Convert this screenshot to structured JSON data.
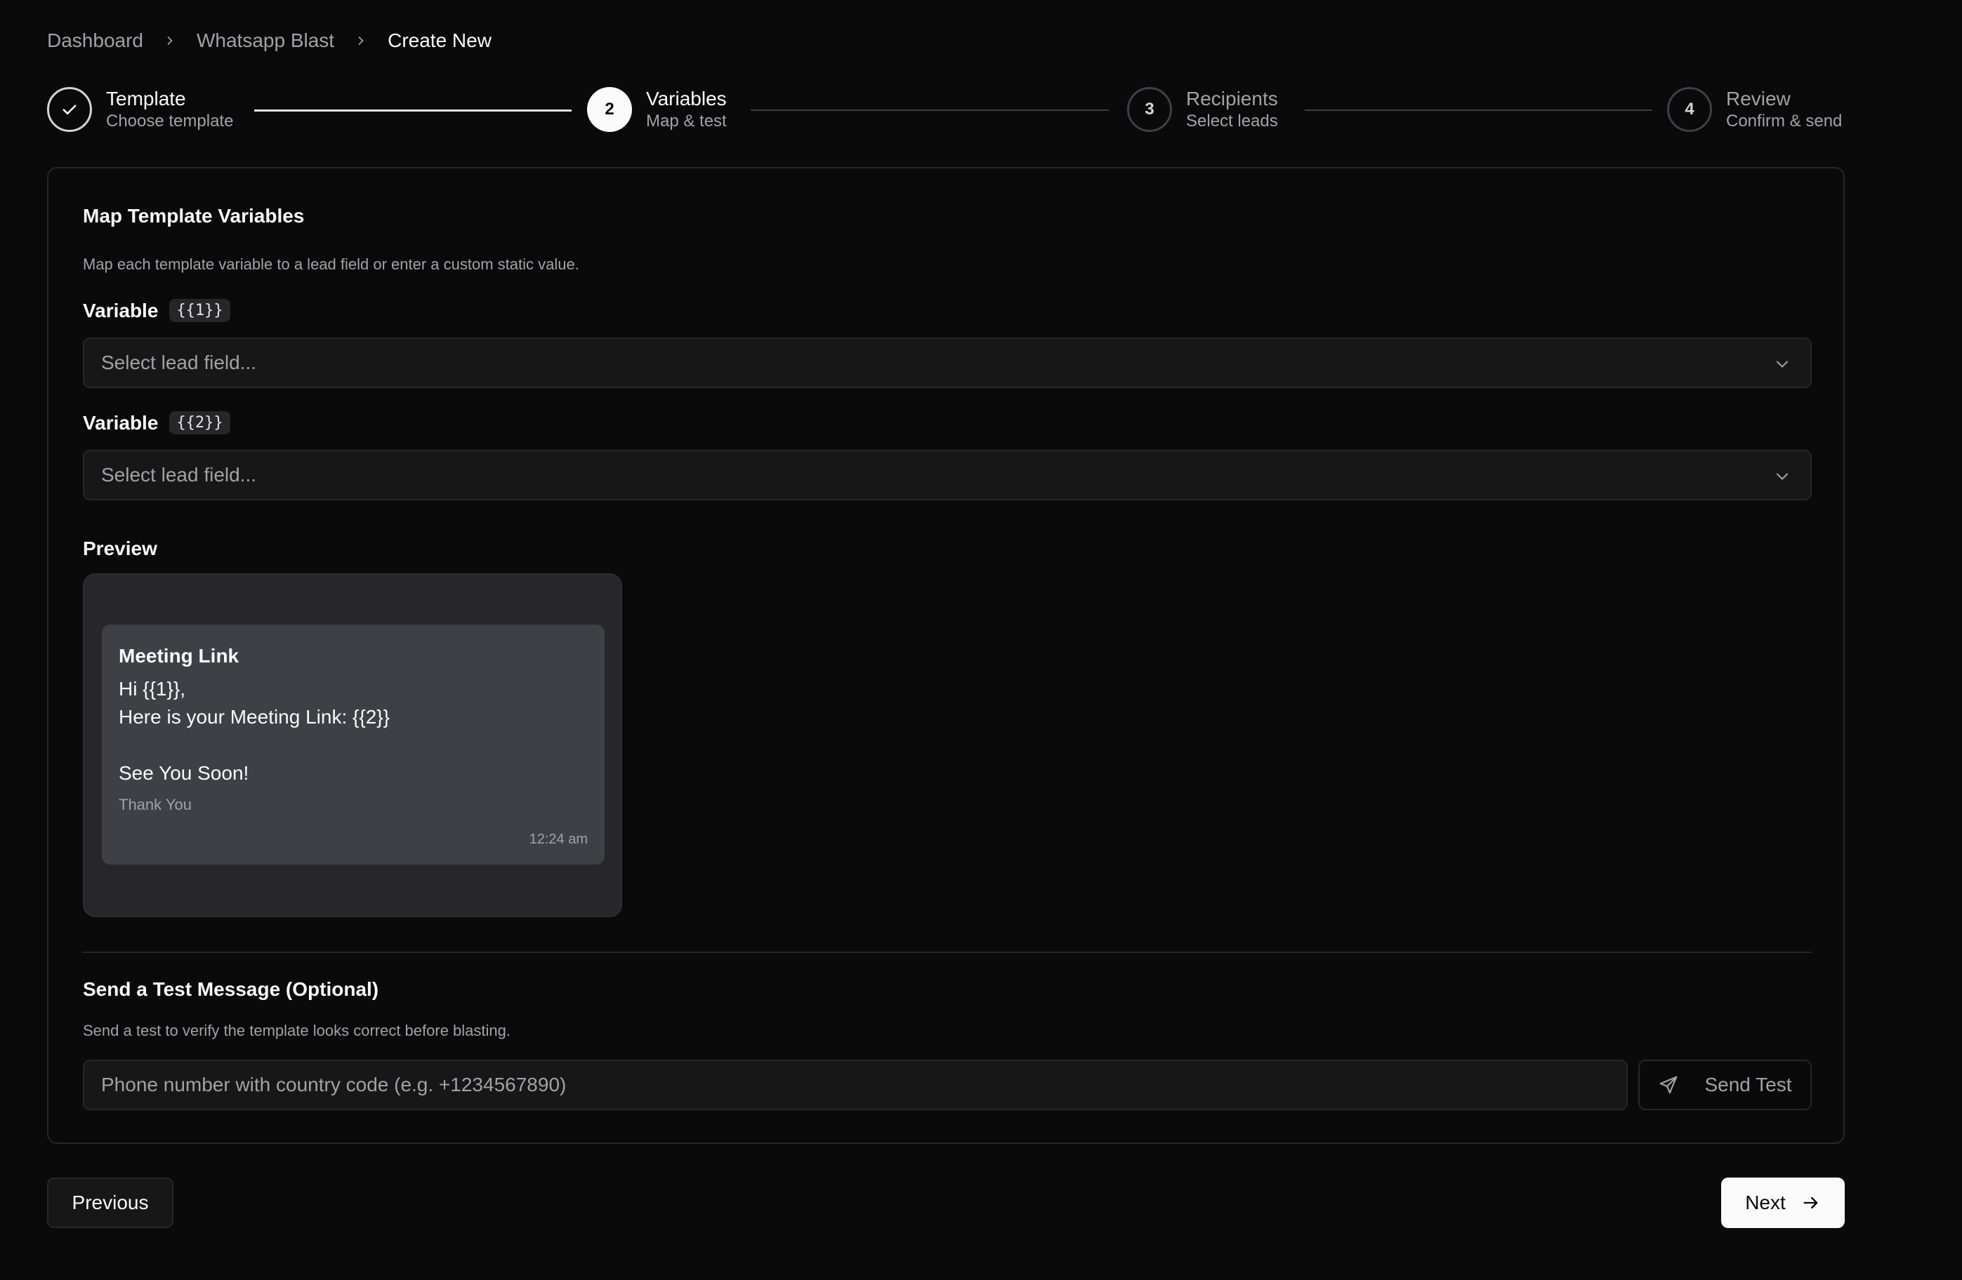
{
  "breadcrumb": {
    "items": [
      "Dashboard",
      "Whatsapp Blast",
      "Create New"
    ]
  },
  "stepper": {
    "steps": [
      {
        "number": "1",
        "title": "Template",
        "subtitle": "Choose template",
        "state": "done"
      },
      {
        "number": "2",
        "title": "Variables",
        "subtitle": "Map & test",
        "state": "active"
      },
      {
        "number": "3",
        "title": "Recipients",
        "subtitle": "Select leads",
        "state": "pending"
      },
      {
        "number": "4",
        "title": "Review",
        "subtitle": "Confirm & send",
        "state": "pending"
      }
    ]
  },
  "mapping": {
    "title": "Map Template Variables",
    "description": "Map each template variable to a lead field or enter a custom static value.",
    "variables": [
      {
        "label": "Variable",
        "token": "{{1}}",
        "placeholder": "Select lead field..."
      },
      {
        "label": "Variable",
        "token": "{{2}}",
        "placeholder": "Select lead field..."
      }
    ]
  },
  "preview": {
    "label": "Preview",
    "message": {
      "title": "Meeting Link",
      "body": "Hi {{1}},\nHere is your Meeting Link: {{2}}\n\nSee You Soon!",
      "footer": "Thank You",
      "time": "12:24 am"
    }
  },
  "test": {
    "title": "Send a Test Message (Optional)",
    "description": "Send a test to verify the template looks correct before blasting.",
    "phone_placeholder": "Phone number with country code (e.g. +1234567890)",
    "send_label": "Send Test"
  },
  "footer": {
    "previous_label": "Previous",
    "next_label": "Next"
  },
  "colors": {
    "background": "#0a0a0a",
    "surface": "#171717",
    "border": "#27272a",
    "muted_text": "#a1a1aa",
    "primary": "#fafafa"
  }
}
